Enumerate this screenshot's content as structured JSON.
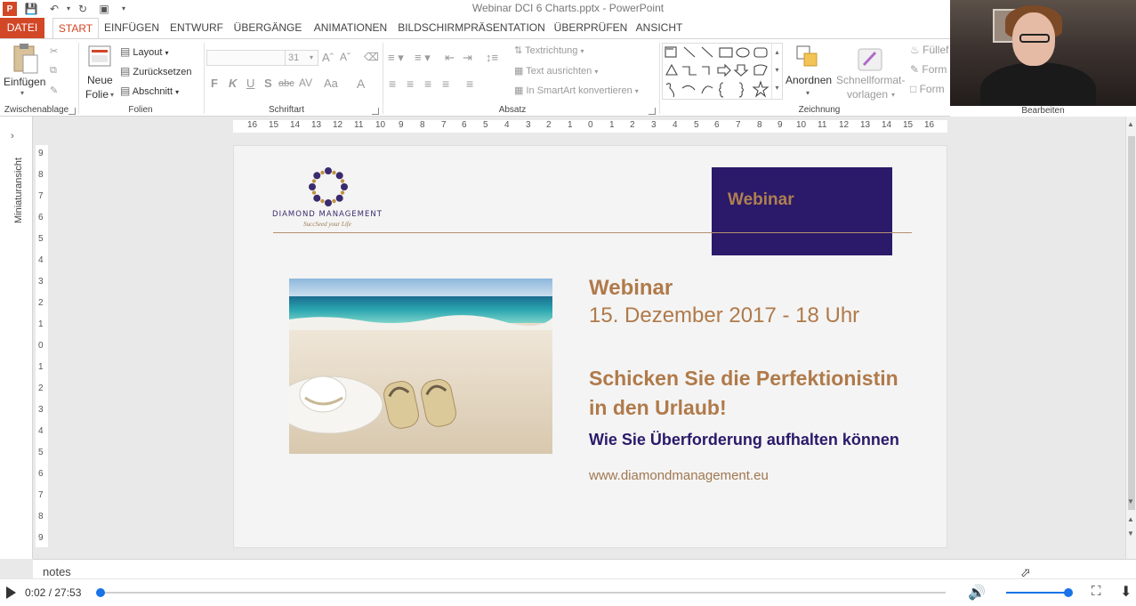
{
  "window": {
    "title": "Webinar DCI 6 Charts.pptx - PowerPoint",
    "app_badge": "P"
  },
  "tabs": [
    "DATEI",
    "START",
    "EINFÜGEN",
    "ENTWURF",
    "ÜBERGÄNGE",
    "ANIMATIONEN",
    "BILDSCHIRMPRÄSENTATION",
    "ÜBERPRÜFEN",
    "ANSICHT"
  ],
  "ribbon": {
    "clipboard": {
      "paste_line1": "Einfügen",
      "label": "Zwischenablage"
    },
    "slides": {
      "new_line1": "Neue",
      "new_line2": "Folie",
      "layout": "Layout",
      "reset": "Zurücksetzen",
      "section": "Abschnitt",
      "label": "Folien"
    },
    "font": {
      "size": "31",
      "label": "Schriftart",
      "bold": "F",
      "italic": "K",
      "underline": "U",
      "shadow": "S",
      "strike": "abc",
      "spacing": "AV",
      "case": "Aa",
      "color": "A"
    },
    "paragraph": {
      "text_direction": "Textrichtung",
      "align_text": "Text ausrichten",
      "smartart": "In SmartArt konvertieren",
      "label": "Absatz"
    },
    "drawing": {
      "arrange": "Anordnen",
      "quick_styles_line1": "Schnellformat-",
      "quick_styles_line2": "vorlagen",
      "label": "Zeichnung",
      "fill": "Füllef",
      "outline": "Form",
      "effects": "Form"
    },
    "editing": {
      "label": "Bearbeiten"
    }
  },
  "thumbnail_pane": {
    "label": "Miniaturansicht"
  },
  "ruler": {
    "horizontal": [
      "16",
      "15",
      "14",
      "13",
      "12",
      "11",
      "10",
      "9",
      "8",
      "7",
      "6",
      "5",
      "4",
      "3",
      "2",
      "1",
      "0",
      "1",
      "2",
      "3",
      "4",
      "5",
      "6",
      "7",
      "8",
      "9",
      "10",
      "11",
      "12",
      "13",
      "14",
      "15",
      "16"
    ],
    "vertical": [
      "9",
      "8",
      "7",
      "6",
      "5",
      "4",
      "3",
      "2",
      "1",
      "0",
      "1",
      "2",
      "3",
      "4",
      "5",
      "6",
      "7",
      "8",
      "9"
    ]
  },
  "slide": {
    "logo_name": "DIAMOND MANAGEMENT",
    "logo_tagline": "SuccSeed your Life",
    "box_title": "Webinar",
    "title": "Webinar",
    "date": "15. Dezember 2017 - 18 Uhr",
    "headline_line1": "Schicken Sie die Perfektionistin",
    "headline_line2": "in den Urlaub!",
    "subheadline": "Wie Sie Überforderung aufhalten können",
    "url": "www.diamondmanagement.eu"
  },
  "notes": {
    "label": "notes"
  },
  "player": {
    "time": "0:02 / 27:53",
    "progress": 0.0012,
    "volume": 1.0
  }
}
